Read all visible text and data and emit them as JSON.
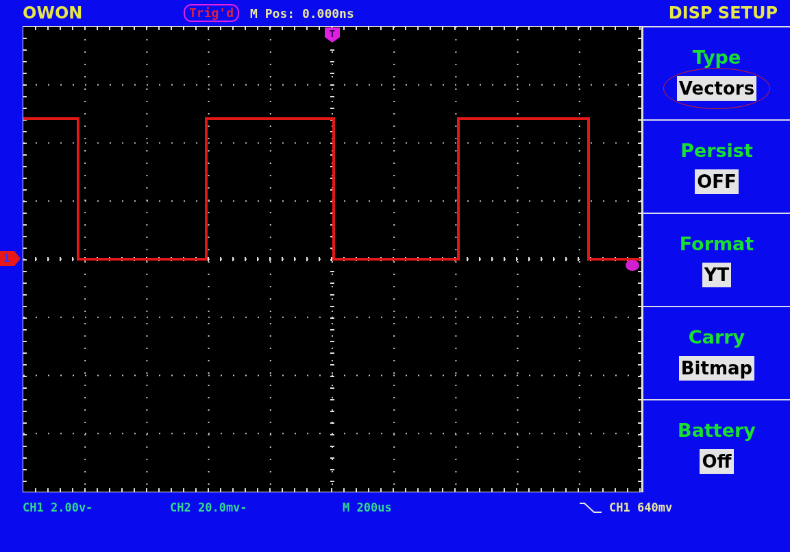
{
  "brand": "OWON",
  "trigger_status": "Trig'd",
  "time_position": "M Pos: 0.000ns",
  "menu_title": "DISP SETUP",
  "trigger_marker": "T",
  "channel_marker": "1",
  "menu": [
    {
      "title": "Type",
      "value": "Vectors",
      "circled": true
    },
    {
      "title": "Persist",
      "value": "OFF",
      "circled": false
    },
    {
      "title": "Format",
      "value": "YT",
      "circled": false
    },
    {
      "title": "Carry",
      "value": "Bitmap",
      "circled": false
    },
    {
      "title": "Battery",
      "value": "Off",
      "circled": false
    }
  ],
  "status_bar": {
    "ch1_scale": "CH1 2.00v-",
    "ch2_scale": "CH2 20.0mv-",
    "timebase": "M 200us",
    "trigger_level": "CH1 640mv"
  }
}
